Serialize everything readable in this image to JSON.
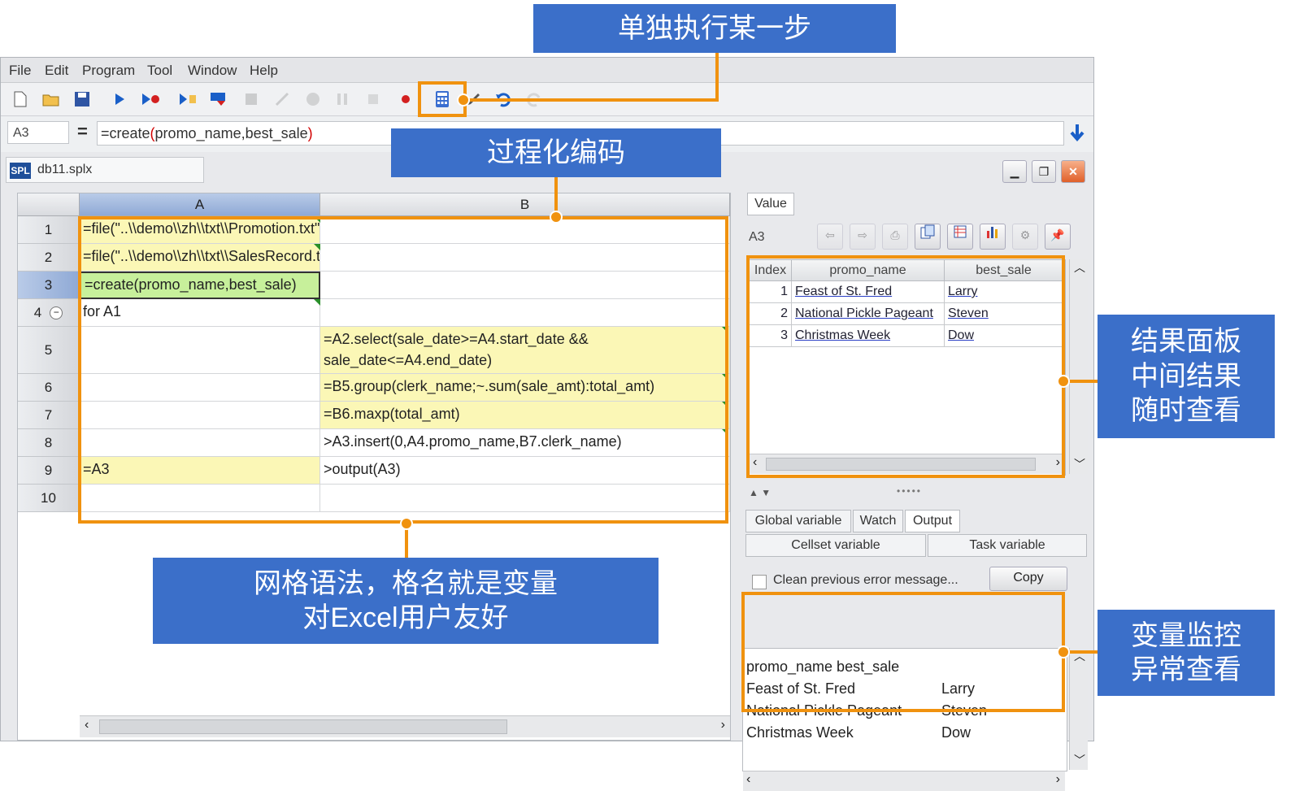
{
  "menu": {
    "file": "File",
    "edit": "Edit",
    "program": "Program",
    "tool": "Tool",
    "window": "Window",
    "help": "Help"
  },
  "formula_bar": {
    "cell_ref": "A3",
    "eq": "=",
    "formula_prefix": "=create",
    "formula_paren_open": "(",
    "formula_args": "promo_name,best_sale",
    "formula_paren_close": ")"
  },
  "file_tab": {
    "badge": "SPL",
    "name": "db11.splx"
  },
  "grid": {
    "columns": [
      "A",
      "B"
    ],
    "rows": [
      {
        "n": "1",
        "a": "=file(\"..\\\\demo\\\\zh\\\\txt\\\\Promotion.txt\").import@t()",
        "b": ""
      },
      {
        "n": "2",
        "a": "=file(\"..\\\\demo\\\\zh\\\\txt\\\\SalesRecord.txt\").import@t()",
        "b": ""
      },
      {
        "n": "3",
        "a": "=create(promo_name,best_sale)",
        "b": ""
      },
      {
        "n": "4",
        "a": "for A1",
        "b": ""
      },
      {
        "n": "5",
        "a": "",
        "b": "=A2.select(sale_date>=A4.start_date &&\nsale_date<=A4.end_date)"
      },
      {
        "n": "6",
        "a": "",
        "b": "=B5.group(clerk_name;~.sum(sale_amt):total_amt)"
      },
      {
        "n": "7",
        "a": "",
        "b": "=B6.maxp(total_amt)"
      },
      {
        "n": "8",
        "a": "",
        "b": ">A3.insert(0,A4.promo_name,B7.clerk_name)"
      },
      {
        "n": "9",
        "a": "=A3",
        "b": ">output(A3)"
      },
      {
        "n": "10",
        "a": "",
        "b": ""
      }
    ]
  },
  "value_panel": {
    "tab": "Value",
    "cell": "A3",
    "headers": [
      "Index",
      "promo_name",
      "best_sale"
    ],
    "rows": [
      {
        "i": "1",
        "promo": "Feast of St. Fred",
        "best": "Larry"
      },
      {
        "i": "2",
        "promo": "National Pickle Pageant",
        "best": "Steven"
      },
      {
        "i": "3",
        "promo": "Christmas Week",
        "best": "Dow"
      }
    ]
  },
  "bottom_panel": {
    "tabs": [
      "Global variable",
      "Watch",
      "Output"
    ],
    "subtabs": [
      "Cellset variable",
      "Task variable"
    ],
    "checkbox_label": "Clean previous error message...",
    "copy_label": "Copy",
    "output_lines": [
      {
        "c1": "promo_name best_sale",
        "c2": ""
      },
      {
        "c1": "Feast of St. Fred",
        "c2": "Larry"
      },
      {
        "c1": "National Pickle Pageant",
        "c2": "Steven"
      },
      {
        "c1": "Christmas Week",
        "c2": "Dow"
      }
    ]
  },
  "callouts": {
    "step": "单独执行某一步",
    "procedural": "过程化编码",
    "grid_line1": "网格语法，格名就是变量",
    "grid_line2": "对Excel用户友好",
    "result_line1": "结果面板",
    "result_line2": "中间结果",
    "result_line3": "随时查看",
    "watch_line1": "变量监控",
    "watch_line2": "异常查看"
  },
  "accent_color": "#f0920f",
  "callout_color": "#3b6fc9"
}
